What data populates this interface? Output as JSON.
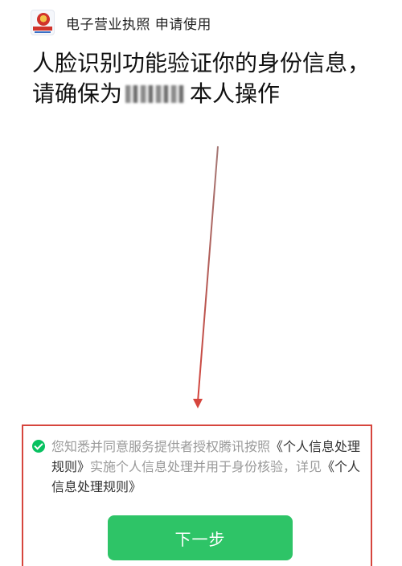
{
  "header": {
    "logo_icon": "business-license-logo-icon",
    "app_name": "电子营业执照 申请使用"
  },
  "title": {
    "line1": "人脸识别功能验证你的身份信息，",
    "line2_prefix": "请确保为",
    "line2_suffix": "本人操作"
  },
  "consent": {
    "checked": true,
    "text_before_link1": "您知悉并同意服务提供者授权腾讯按照",
    "link1": "《个人信息处理规则》",
    "text_middle": "实施个人信息处理并用于身份核验，详见",
    "link2": "《个人信息处理规则》"
  },
  "button": {
    "next_label": "下一步"
  },
  "colors": {
    "accent_green": "#2ec467",
    "annotation_red": "#d6453d"
  }
}
